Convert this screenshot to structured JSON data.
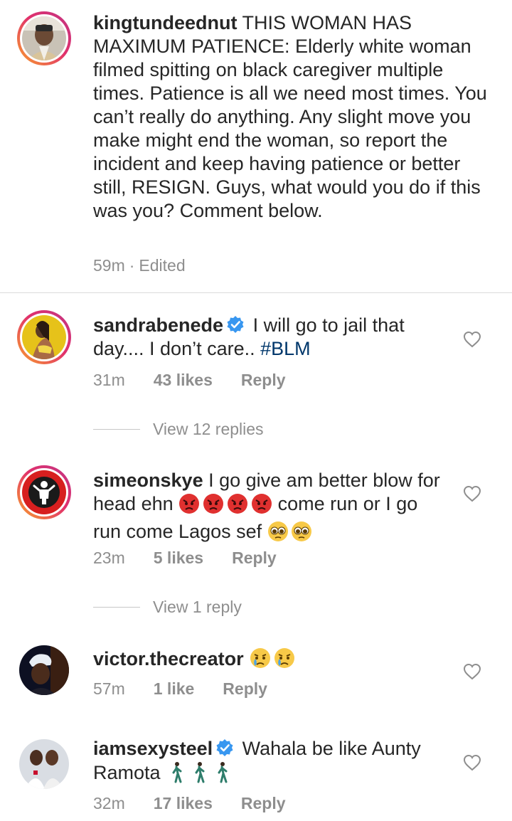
{
  "caption": {
    "username": "kingtundeednut",
    "text": "THIS WOMAN HAS MAXIMUM PATIENCE: Elderly white woman filmed spitting on black caregiver multiple times. Patience is all we need most times. You can’t really do anything. Any slight move you make might end the woman, so report the incident and keep having patience or better still, RESIGN. Guys, what would you do if this was you? Comment below.",
    "time": "59m",
    "separator": "·",
    "edited": "Edited"
  },
  "comments": [
    {
      "username": "sandrabenede",
      "verified": true,
      "text": "I will go to jail that day.... I don’t care..",
      "hashtag": "#BLM",
      "time": "31m",
      "likes": "43 likes",
      "reply": "Reply",
      "view_replies": "View 12 replies"
    },
    {
      "username": "simeonskye",
      "verified": false,
      "text_1": "I go give am better blow for head ehn",
      "text_2": "come run or I go run come Lagos sef",
      "time": "23m",
      "likes": "5 likes",
      "reply": "Reply",
      "view_replies": "View 1 reply"
    },
    {
      "username": "victor.thecreator",
      "verified": false,
      "time": "57m",
      "likes": "1 like",
      "reply": "Reply"
    },
    {
      "username": "iamsexysteel",
      "verified": true,
      "text": "Wahala be like Aunty Ramota",
      "time": "32m",
      "likes": "17 likes",
      "reply": "Reply"
    }
  ],
  "icons": {
    "verified": "verified-badge-icon",
    "like": "heart-outline-icon",
    "angry": "angry-face-emoji",
    "pleading": "pleading-face-emoji",
    "crying": "crying-face-emoji",
    "walking": "walking-person-emoji"
  },
  "colors": {
    "text": "#262626",
    "muted": "#8e8e8e",
    "link": "#00376b",
    "verified": "#3897f0",
    "divider": "#dbdbdb"
  }
}
